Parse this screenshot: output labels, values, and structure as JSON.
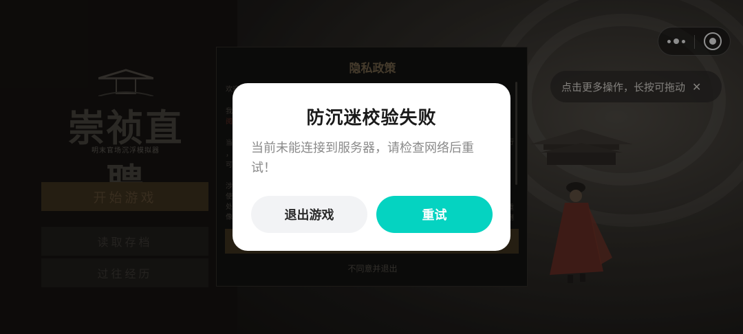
{
  "game": {
    "logo_title": "崇祯直聘",
    "logo_subtitle": "明末官场沉浮模拟器",
    "menu": {
      "start": "开始游戏",
      "load": "读取存档",
      "history": "过往经历"
    }
  },
  "privacy": {
    "title": "隐私政策",
    "decline": "不同意并退出",
    "fragments": {
      "welcome": "欢迎",
      "we": "我",
      "read": "阅",
      "when": "当",
      "comma": "，",
      "can": "可",
      "involve": "涉",
      "use": "使",
      "handle": "处",
      "image": "像",
      "r_row": "行",
      "r_heavy": "重",
      "r_delete": "删"
    }
  },
  "capsule": {
    "more_icon": "more-dots-icon",
    "close_icon": "target-close-icon"
  },
  "hint": {
    "text": "点击更多操作，长按可拖动",
    "close_symbol": "✕"
  },
  "dialog": {
    "title": "防沉迷校验失败",
    "message": "当前未能连接到服务器，请检查网络后重试！",
    "exit_label": "退出游戏",
    "retry_label": "重试"
  },
  "colors": {
    "accent": "#05d3c1",
    "dialog_bg": "#ffffff",
    "exit_bg": "#f2f3f5"
  }
}
